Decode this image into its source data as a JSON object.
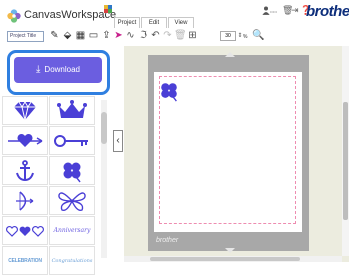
{
  "app": {
    "name": "CanvasWorkspace",
    "brand": "brother",
    "user_name": "•••••"
  },
  "menu": {
    "items": [
      "Project",
      "Edit",
      "View"
    ]
  },
  "toolbar": {
    "project_title_placeholder": "Project Title",
    "zoom_value": "30",
    "zoom_unit": "%"
  },
  "download": {
    "label": "Download"
  },
  "library": {
    "items": [
      "diamond",
      "crown",
      "heart-arrow",
      "ornate-key",
      "anchor",
      "four-leaf-clover",
      "bow-arrow",
      "butterfly",
      "hearts-row",
      "Anniversary",
      "CELEBRATION",
      "Congratulations"
    ]
  },
  "colors": {
    "download_button": "#6b5ee0",
    "highlight_border": "#2f7fe0",
    "clover": "#4a3fd6",
    "brand": "#0d2e7b",
    "cut_guide": "#ee8cb0"
  }
}
